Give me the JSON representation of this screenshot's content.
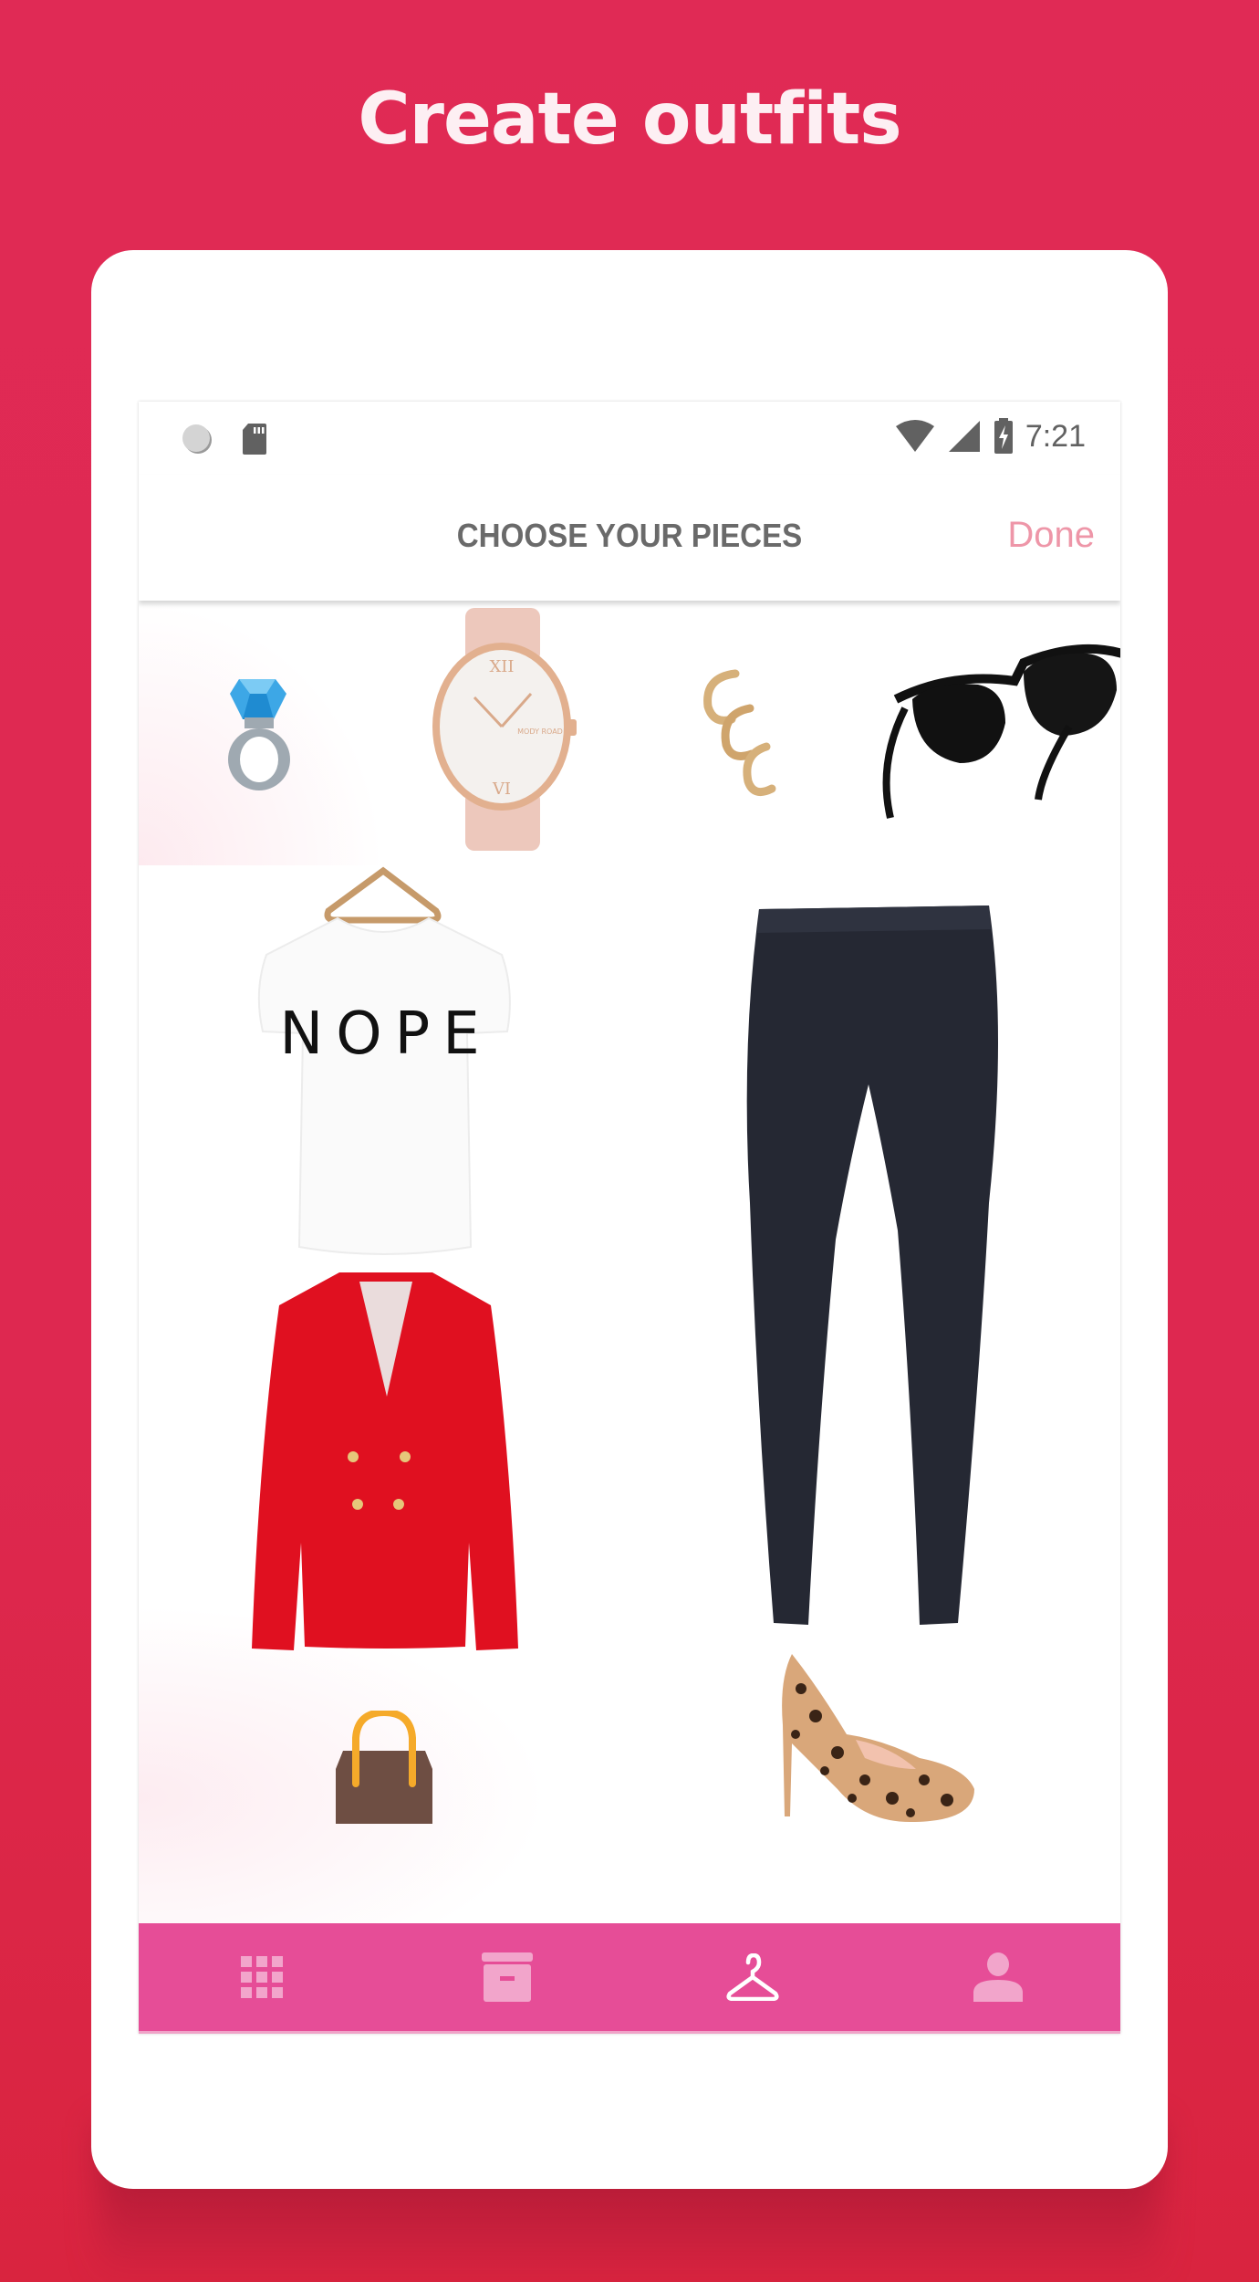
{
  "headline": "Create outfits",
  "status_bar": {
    "left_icons": [
      "sync-icon",
      "sd-card-icon"
    ],
    "right_icons": [
      "wifi-icon",
      "signal-icon",
      "battery-charging-icon"
    ],
    "time": "7:21"
  },
  "app_bar": {
    "title": "CHOOSE YOUR PIECES",
    "done_label": "Done"
  },
  "canvas": {
    "items": [
      {
        "name": "ring",
        "icon": "diamond-ring"
      },
      {
        "name": "watch",
        "icon": "wristwatch",
        "dial_text": "MODY ROAD"
      },
      {
        "name": "earrings",
        "icon": "ear-cuffs"
      },
      {
        "name": "sunglasses",
        "icon": "sunglasses"
      },
      {
        "name": "t-shirt",
        "icon": "tshirt",
        "print_text": "NOPE"
      },
      {
        "name": "jeans",
        "icon": "skinny-jeans"
      },
      {
        "name": "blazer",
        "icon": "red-blazer"
      },
      {
        "name": "handbag",
        "icon": "handbag"
      },
      {
        "name": "heels",
        "icon": "leopard-pumps"
      }
    ]
  },
  "bottom_nav": {
    "items": [
      {
        "name": "grid",
        "icon": "grid-icon",
        "active": false
      },
      {
        "name": "closet",
        "icon": "archive-icon",
        "active": false
      },
      {
        "name": "outfits",
        "icon": "hanger-icon",
        "active": true
      },
      {
        "name": "profile",
        "icon": "person-icon",
        "active": false
      }
    ]
  },
  "colors": {
    "background": "#E02A55",
    "accent_nav": "#E64D97",
    "done": "#EE96A8",
    "title": "#6A6A6A",
    "nav_inactive": "#F2A5CB",
    "nav_active": "#FFFFFF"
  }
}
